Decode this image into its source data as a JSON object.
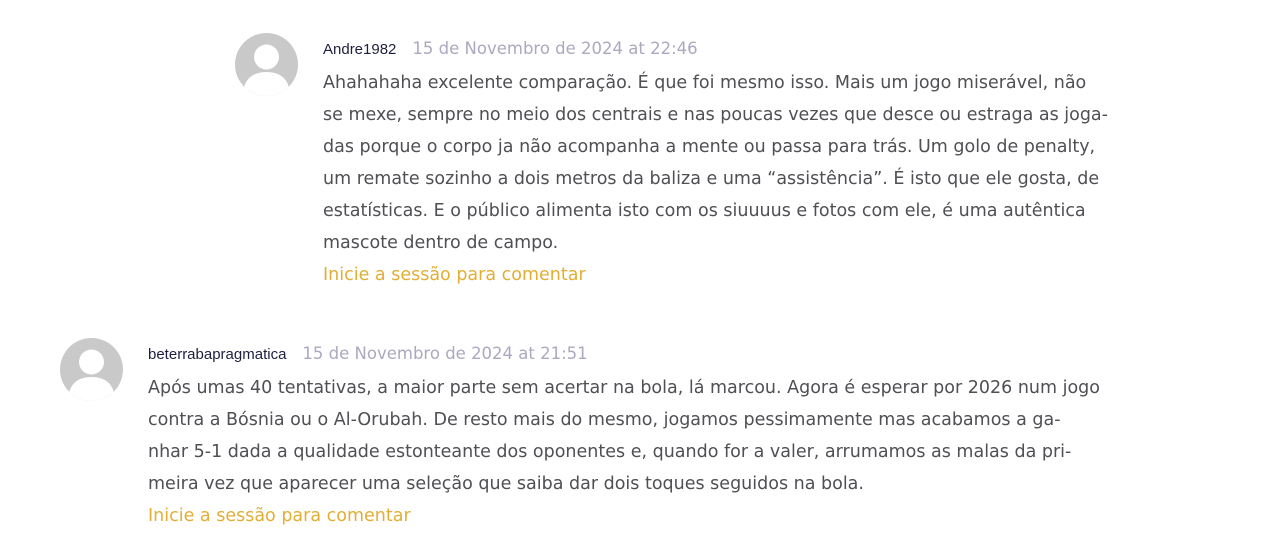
{
  "comments": [
    {
      "author": "Andre1982",
      "date": "15 de Novembro de 2024 at 22:46",
      "lines": [
        "Ahahahaha excelente comparação. É que foi mesmo isso. Mais um jogo miserável, não",
        "se mexe, sempre no meio dos centrais e nas poucas vezes que desce ou estraga as joga-",
        "das porque o corpo ja não acompanha a mente ou passa para trás. Um golo de penalty,",
        "um remate sozinho a dois metros da baliza e uma “assistência”. É isto que ele gosta, de",
        "estatísticas. E o público alimenta isto com os siuuuus e fotos com ele, é uma autêntica",
        "mascote dentro de campo."
      ],
      "action_label": "Inicie a sessão para comentar",
      "avatar_icon": "default-user-avatar-icon"
    },
    {
      "author": "beterrabapragmatica",
      "date": "15 de Novembro de 2024 at 21:51",
      "lines": [
        "Após umas 40 tentativas, a maior parte sem acertar na bola, lá marcou. Agora é esperar por 2026 num jogo",
        "contra a Bósnia ou o Al-Orubah. De resto mais do mesmo, jogamos pessimamente mas acabamos a ga-",
        "nhar 5-1 dada a qualidade estonteante dos oponentes e, quando for a valer, arrumamos as malas da pri-",
        "meira vez que aparecer uma seleção que saiba dar dois toques seguidos na bola."
      ],
      "action_label": "Inicie a sessão para comentar",
      "avatar_icon": "default-user-avatar-icon"
    }
  ],
  "colors": {
    "author": "#1e1e3f",
    "date": "#aaa9bf",
    "text": "#4f4f54",
    "link": "#e2ae35",
    "avatar_bg": "#c9c9c9",
    "avatar_fg": "#ffffff"
  }
}
